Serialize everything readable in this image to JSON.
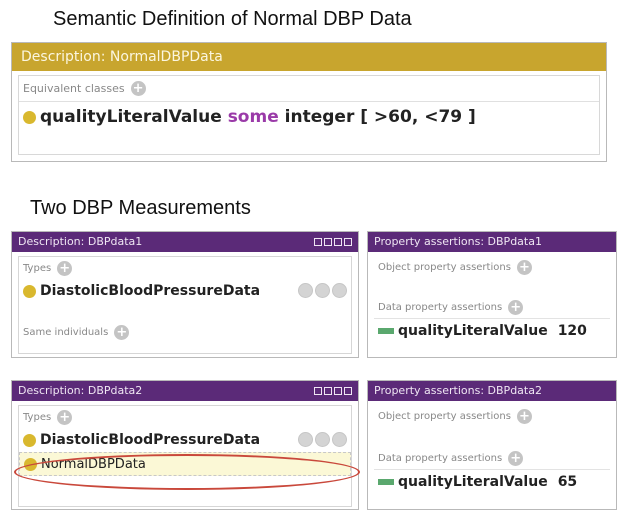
{
  "captions": {
    "semantic": "Semantic Definition of Normal DBP Data",
    "measurements": "Two DBP Measurements"
  },
  "top_panel": {
    "header": "Description: NormalDBPData",
    "label": "Equivalent classes",
    "expr_property": "qualityLiteralValue",
    "expr_keyword": "some",
    "expr_type": "integer [ >60, <79 ]"
  },
  "dbp1": {
    "desc_header": "Description: DBPdata1",
    "types_label": "Types",
    "type_value": "DiastolicBloodPressureData",
    "same_label": "Same individuals",
    "prop_header": "Property assertions: DBPdata1",
    "obj_label": "Object property assertions",
    "data_label": "Data property assertions",
    "prop_name": "qualityLiteralValue",
    "prop_value": "120"
  },
  "dbp2": {
    "desc_header": "Description: DBPdata2",
    "types_label": "Types",
    "type_value": "DiastolicBloodPressureData",
    "inferred_type": "NormalDBPData",
    "prop_header": "Property assertions: DBPdata2",
    "obj_label": "Object property assertions",
    "data_label": "Data property assertions",
    "prop_name": "qualityLiteralValue",
    "prop_value": "65"
  },
  "colors": {
    "class_header": "#c8a52e",
    "individual_header": "#5b2a78",
    "keyword": "#9a3aa8",
    "highlight_ellipse": "#c9483b"
  }
}
